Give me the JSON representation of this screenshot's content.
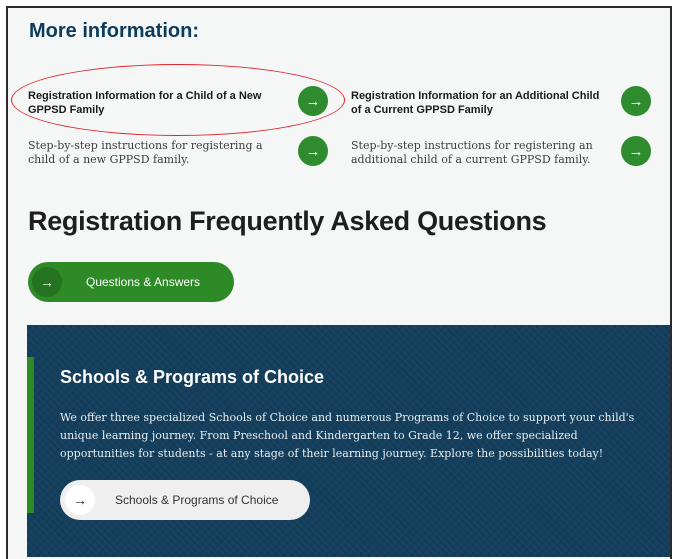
{
  "more_info": {
    "heading": "More information:",
    "cards": [
      {
        "title": "Registration Information for a Child of a New GPPSD Family",
        "arrow_icon": "arrow-right-icon"
      },
      {
        "title": "Registration Information for an Additional Child of a Current GPPSD Family",
        "arrow_icon": "arrow-right-icon"
      },
      {
        "description": "Step-by-step instructions for registering a child of a new GPPSD family.",
        "arrow_icon": "arrow-right-icon"
      },
      {
        "description": "Step-by-step instructions for registering an additional child of a current GPPSD family.",
        "arrow_icon": "arrow-right-icon"
      }
    ],
    "arrow_glyph": "→"
  },
  "faq": {
    "heading": "Registration Frequently Asked Questions",
    "button_label": "Questions & Answers",
    "arrow_glyph": "→"
  },
  "choice": {
    "heading": "Schools & Programs of Choice",
    "description": "We offer three specialized Schools of Choice and numerous Programs of Choice to support your child's unique learning journey. From Preschool and Kindergarten to Grade 12, we offer specialized opportunities for students - at any stage of their learning journey. Explore the possibilities today!",
    "button_label": "Schools & Programs of Choice",
    "arrow_glyph": "→"
  },
  "colors": {
    "heading_blue": "#0d3b5b",
    "brand_green": "#2d8a26",
    "panel_navy": "#133e5c",
    "highlight_red": "#e0242a"
  }
}
